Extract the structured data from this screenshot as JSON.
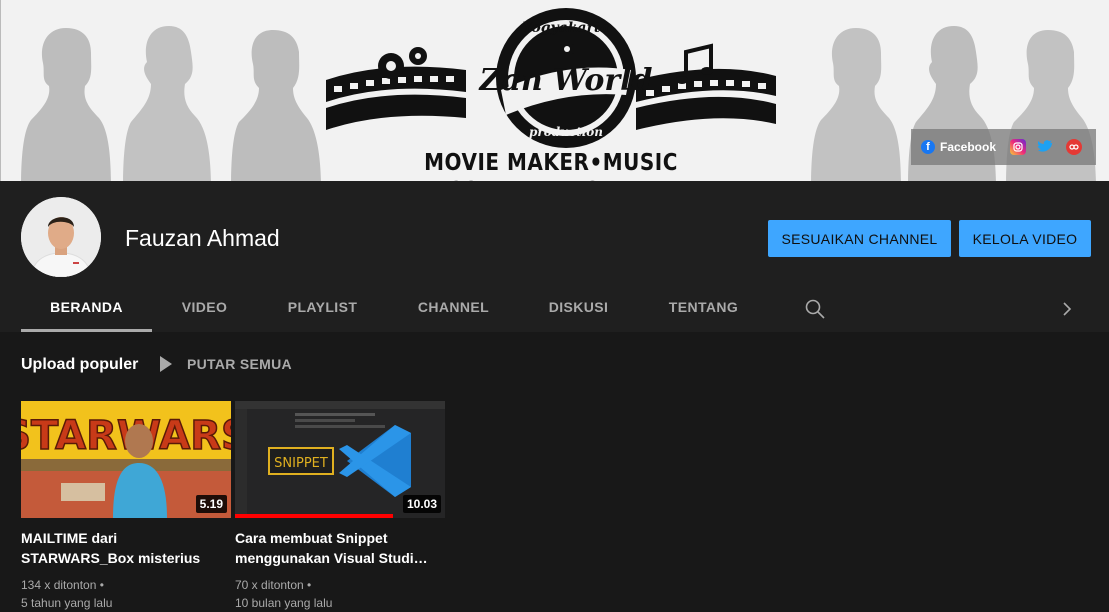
{
  "banner": {
    "logo_top_text": "Yogyakarta",
    "logo_main_text": "Zan World",
    "logo_bottom_text": "production",
    "tagline": "MOVIE MAKER•MUSIC COVER•TUTORIAL",
    "links": {
      "facebook_label": "Facebook",
      "icons": [
        "instagram-icon",
        "twitter-icon",
        "other-link-icon"
      ]
    }
  },
  "channel": {
    "name": "Fauzan Ahmad",
    "customize_label": "SESUAIKAN CHANNEL",
    "manage_label": "KELOLA VIDEO"
  },
  "tabs": [
    {
      "label": "BERANDA",
      "active": true
    },
    {
      "label": "VIDEO"
    },
    {
      "label": "PLAYLIST"
    },
    {
      "label": "CHANNEL"
    },
    {
      "label": "DISKUSI"
    },
    {
      "label": "TENTANG"
    }
  ],
  "section": {
    "title": "Upload populer",
    "play_all": "PUTAR SEMUA"
  },
  "videos": [
    {
      "thumb_text": "STARWARS",
      "duration": "5.19",
      "title": "MAILTIME dari STARWARS_Box misterius",
      "views": "134 x ditonton •",
      "age": "5 tahun yang lalu"
    },
    {
      "thumb_text": "SNIPPET",
      "duration": "10.03",
      "title": "Cara membuat Snippet menggunakan Visual Studi…",
      "views": "70 x ditonton •",
      "age": "10 bulan yang lalu",
      "watched_fraction": 0.75
    }
  ],
  "colors": {
    "accent": "#3ea6ff",
    "background": "#181818",
    "header": "#1f1f1f",
    "progress": "#ff0000"
  }
}
